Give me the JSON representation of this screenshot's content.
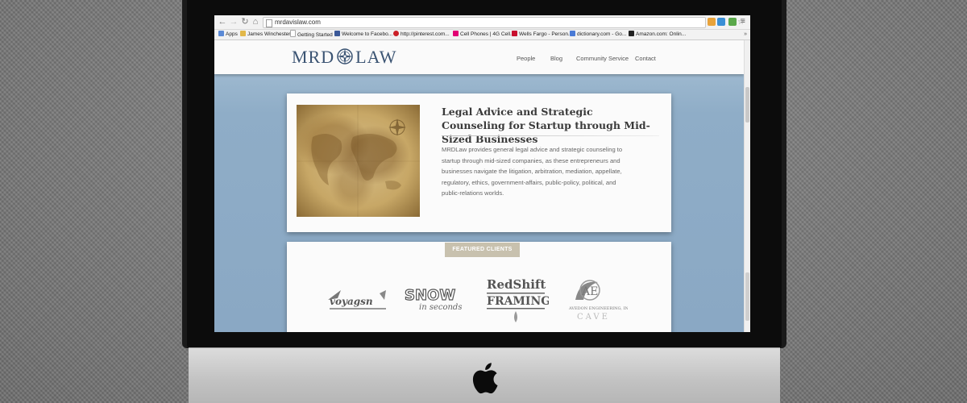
{
  "browser": {
    "url": "mrdavislaw.com",
    "bookmarks": [
      {
        "label": "Apps",
        "color": "#5b8ad6"
      },
      {
        "label": "James Winchester",
        "color": "#e2b84a"
      },
      {
        "label": "Getting Started",
        "color": "#cfcfcf"
      },
      {
        "label": "Welcome to Facebo...",
        "color": "#3b5998"
      },
      {
        "label": "http://pinterest.com...",
        "color": "#cb2027"
      },
      {
        "label": "Cell Phones | 4G Cell...",
        "color": "#e20074"
      },
      {
        "label": "Wells Fargo - Person...",
        "color": "#c8102e"
      },
      {
        "label": "dictionary.com - Go...",
        "color": "#4a7bd6"
      },
      {
        "label": "Amazon.com: Onlin...",
        "color": "#222222"
      }
    ],
    "more": "»"
  },
  "site": {
    "logo_left": "MRD",
    "logo_right": "LAW",
    "nav": [
      "People",
      "Blog",
      "Community Service",
      "Contact"
    ],
    "card": {
      "title": "Legal Advice and Strategic Counseling for Startup through Mid-Sized Businesses",
      "body": "MRDLaw provides general legal advice and strategic counseling to startup through mid-sized companies, as these entrepreneurs and businesses navigate the litigation, arbitration, mediation, appellate, regulatory, ethics, government-affairs, public-policy, political, and public-relations worlds."
    },
    "featured_tab": "FEATURED CLIENTS"
  },
  "colors": {
    "site_bg": "#8aa8c4",
    "logo": "#3b5473",
    "tab": "#c8c1ae"
  }
}
